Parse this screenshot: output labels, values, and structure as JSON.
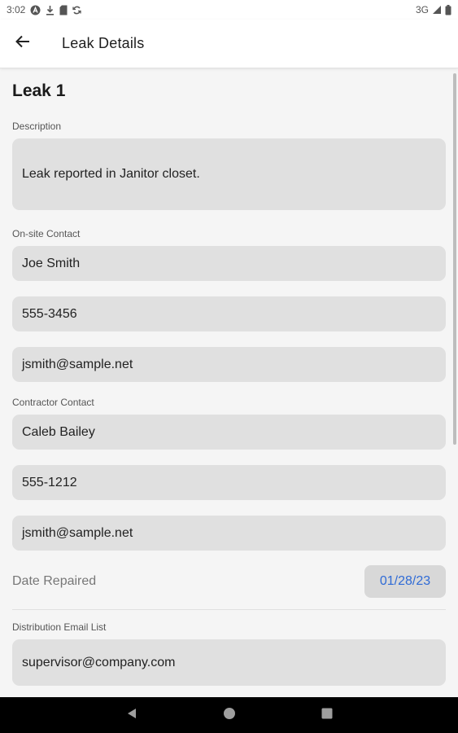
{
  "status_bar": {
    "time": "3:02",
    "network": "3G",
    "icons": [
      "a-circle-icon",
      "download-icon",
      "sim-card-icon",
      "sync-icon",
      "signal-icon",
      "battery-icon"
    ]
  },
  "app_bar": {
    "title": "Leak Details",
    "back_icon": "arrow-left-icon"
  },
  "leak": {
    "title": "Leak 1",
    "description_label": "Description",
    "description_value": "Leak reported in Janitor closet.",
    "onsite_label": "On-site Contact",
    "onsite_name": "Joe Smith",
    "onsite_phone": "555-3456",
    "onsite_email": "jsmith@sample.net",
    "contractor_label": "Contractor Contact",
    "contractor_name": "Caleb Bailey",
    "contractor_phone": "555-1212",
    "contractor_email": "jsmith@sample.net",
    "date_label": "Date Repaired",
    "date_value": "01/28/23",
    "distribution_label": "Distribution Email List",
    "distribution_value": "supervisor@company.com"
  },
  "nav_bar": {
    "icons": [
      "back-triangle-icon",
      "home-circle-icon",
      "recents-square-icon"
    ]
  },
  "colors": {
    "accent": "#2f6bd6",
    "field_bg": "#e0e0e0",
    "page_bg": "#f5f5f5"
  }
}
